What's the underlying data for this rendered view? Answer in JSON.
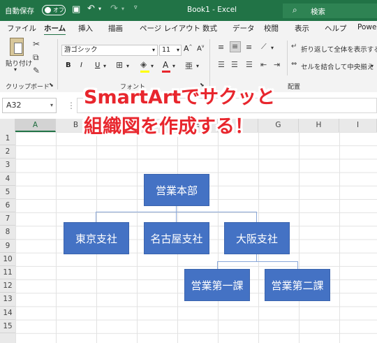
{
  "titlebar": {
    "autosave_label": "自動保存",
    "toggle_state": "オフ",
    "filename": "Book1 - Excel",
    "search_placeholder": "検索"
  },
  "tabs": [
    "ファイル",
    "ホーム",
    "挿入",
    "描画",
    "ページ レイアウト",
    "数式",
    "データ",
    "校閲",
    "表示",
    "ヘルプ",
    "Power"
  ],
  "ribbon": {
    "paste_label": "貼り付け",
    "clipboard_group": "クリップボード",
    "font_name": "游ゴシック",
    "font_size": "11",
    "font_group": "フォント",
    "bold": "B",
    "italic": "I",
    "underline": "U",
    "wrap_text": "折り返して全体を表示する",
    "merge_center": "セルを結合して中央揃え",
    "alignment_group": "配置"
  },
  "formula_bar": {
    "name_box": "A32"
  },
  "columns": [
    "A",
    "B",
    "C",
    "D",
    "E",
    "F",
    "G",
    "H",
    "I"
  ],
  "rows": [
    "1",
    "2",
    "3",
    "4",
    "5",
    "6",
    "7",
    "8",
    "9",
    "10",
    "11",
    "12",
    "13",
    "14",
    "15"
  ],
  "overlay": {
    "line1": "SmartArtでサクッと",
    "line2": "組織図を作成する！"
  },
  "org_chart": {
    "root": "営業本部",
    "level2": [
      "東京支社",
      "名古屋支社",
      "大阪支社"
    ],
    "level3": [
      "営業第一課",
      "営業第二課"
    ]
  },
  "colors": {
    "excel_green": "#217346",
    "node_blue": "#4472c4",
    "headline_red": "#e8262d"
  }
}
